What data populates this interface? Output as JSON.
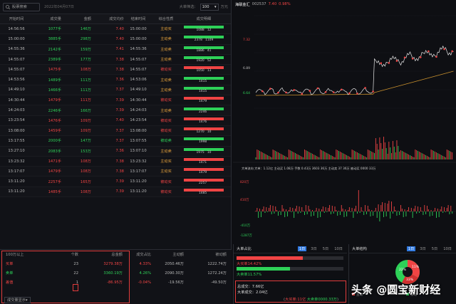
{
  "toolbar": {
    "search_placeholder": "股票搜索",
    "date": "2022年04月07日",
    "filter_label": "大单筛选：",
    "filter_value": "100",
    "filter_unit": "万元"
  },
  "table": {
    "headers": [
      "开始时间",
      "成交量",
      "金额",
      "成交均价",
      "结束时间",
      "综合性质",
      "成交明细"
    ],
    "rows": [
      [
        "14:56:56",
        "1077手",
        "146万",
        "7.40",
        "15:00:00",
        "主动买",
        "1088",
        "12",
        "g"
      ],
      [
        "15:00:00",
        "3885手",
        "298万",
        "7.40",
        "15:00:00",
        "主动卖",
        "2378",
        "1109",
        "g"
      ],
      [
        "14:55:36",
        "2142手",
        "159万",
        "7.41",
        "14:55:36",
        "主动卖",
        "1886",
        "41",
        "g"
      ],
      [
        "14:55:07",
        "2389手",
        "177万",
        "7.38",
        "14:55:07",
        "主动卖",
        "1920",
        "52",
        "g"
      ],
      [
        "14:55:07",
        "1475手",
        "108万",
        "7.38",
        "14:55:07",
        "被动买",
        "1050",
        "13",
        "r"
      ],
      [
        "14:53:56",
        "1489手",
        "111万",
        "7.36",
        "14:53:06",
        "主动卖",
        "1415",
        "",
        "g"
      ],
      [
        "14:49:10",
        "1466手",
        "111万",
        "7.37",
        "14:49:10",
        "主动卖",
        "1415",
        "",
        "g"
      ],
      [
        "14:30:44",
        "1479手",
        "111万",
        "7.39",
        "14:30:44",
        "被动买",
        "1479",
        "",
        "r"
      ],
      [
        "14:24:03",
        "2246手",
        "166万",
        "7.39",
        "14:24:03",
        "主动卖",
        "2246",
        "",
        "g"
      ],
      [
        "13:23:54",
        "1476手",
        "109万",
        "7.40",
        "14:23:54",
        "被动买",
        "1476",
        "",
        "r"
      ],
      [
        "13:08:00",
        "1459手",
        "109万",
        "7.37",
        "13:08:00",
        "被动买",
        "1270",
        "10",
        "r"
      ],
      [
        "13:17:55",
        "2000手",
        "147万",
        "7.37",
        "13:07:55",
        "被动卖",
        "1998",
        "",
        "g"
      ],
      [
        "13:27:10",
        "2083手",
        "153万",
        "7.36",
        "13:07:10",
        "主动卖",
        "1975",
        "10",
        "g"
      ],
      [
        "13:23:32",
        "1471手",
        "108万",
        "7.38",
        "13:23:32",
        "主动买",
        "1471",
        "",
        "r"
      ],
      [
        "13:17:07",
        "1479手",
        "108万",
        "7.38",
        "13:17:07",
        "主动买",
        "1479",
        "",
        "r"
      ],
      [
        "13:11:20",
        "2257手",
        "165万",
        "7.39",
        "13:11:20",
        "被动买",
        "2257",
        "",
        "r"
      ],
      [
        "13:11:20",
        "1485手",
        "108万",
        "7.39",
        "13:11:20",
        "被动买",
        "1485",
        "",
        "r"
      ]
    ]
  },
  "summary": {
    "headers": [
      "100万以上",
      "个数",
      "总金额",
      "成交占比",
      "主动额",
      "被动额"
    ],
    "rows": [
      {
        "label": "买单",
        "count": "23",
        "amount": "3279.38万",
        "ratio": "4.33%",
        "active": "2050.46万",
        "passive": "1222.74万",
        "cls": "r"
      },
      {
        "label": "卖单",
        "count": "22",
        "amount": "3360.19万",
        "ratio": "4.26%",
        "active": "2090.30万",
        "passive": "1272.24万",
        "cls": "g"
      },
      {
        "label": "差值",
        "count": "1",
        "amount": "-86.95万",
        "ratio": "-0.04%",
        "active": "-19.56万",
        "passive": "-49.50万",
        "cls": "r"
      }
    ],
    "more_button": "成交量显示"
  },
  "chart_header": {
    "name": "海联金汇",
    "code": "002537",
    "price": "7.40",
    "change": "0.98%"
  },
  "price_axis": {
    "ticks": [
      "7.32",
      "6.89",
      "6.64"
    ]
  },
  "big_order_header": "大单流向 大单：1.12亿 主动买 1.08万 手数 0.43万 3603 36万 主动卖 37 36万 被动买 0000 33万",
  "flow_axis": {
    "ticks": [
      "820万",
      "410万",
      "-410万",
      "-1287万"
    ]
  },
  "ratio_panel": {
    "title": "大单占比",
    "tabs": [
      "1日",
      "3日",
      "5日",
      "10日"
    ],
    "buy_label": "大买单14.42%",
    "sell_label": "大卖单11.57%",
    "total": "总成交：7.66亿",
    "big_total": "大单成交：2.04亿",
    "footnote_buy": "大买单:11亿",
    "footnote_sell": "大卖单0000.33万"
  },
  "struct_panel": {
    "title": "大单结构",
    "tabs": [
      "1日",
      "3日",
      "5日",
      "10日"
    ],
    "pie_labels": [
      "11%",
      "22%",
      "33%"
    ],
    "legend": [
      "主动",
      "被动"
    ]
  },
  "watermark": "头条 @圆宝新财经",
  "colors": {
    "up": "#f04444",
    "down": "#2ed158",
    "accent": "#2e78e0",
    "ma": "#c8902e"
  }
}
